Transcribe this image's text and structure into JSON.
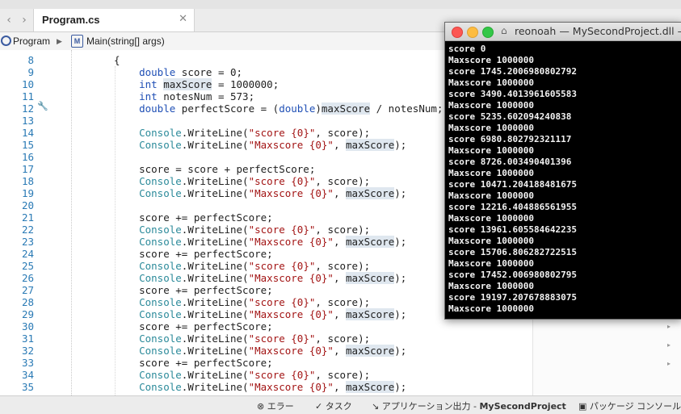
{
  "tabbar": {
    "back": "‹",
    "forward": "›",
    "tab_label": "Program.cs",
    "tab_close": "✕"
  },
  "breadcrumb": {
    "item1": "Program",
    "separator": "▶",
    "item2": "Main(string[] args)",
    "method_icon_text": "M"
  },
  "code": {
    "lines": [
      {
        "n": "8",
        "t": "{"
      },
      {
        "n": "9",
        "t": "    double score = 0;"
      },
      {
        "n": "10",
        "t": "    int maxScore = 1000000;"
      },
      {
        "n": "11",
        "t": "    int notesNum = 573;"
      },
      {
        "n": "12",
        "t": "    double perfectScore = (double)maxScore / notesNum;"
      },
      {
        "n": "13",
        "t": ""
      },
      {
        "n": "14",
        "t": "    Console.WriteLine(\"score {0}\", score);"
      },
      {
        "n": "15",
        "t": "    Console.WriteLine(\"Maxscore {0}\", maxScore);"
      },
      {
        "n": "16",
        "t": ""
      },
      {
        "n": "17",
        "t": "    score = score + perfectScore;"
      },
      {
        "n": "18",
        "t": "    Console.WriteLine(\"score {0}\", score);"
      },
      {
        "n": "19",
        "t": "    Console.WriteLine(\"Maxscore {0}\", maxScore);"
      },
      {
        "n": "20",
        "t": ""
      },
      {
        "n": "21",
        "t": "    score += perfectScore;"
      },
      {
        "n": "22",
        "t": "    Console.WriteLine(\"score {0}\", score);"
      },
      {
        "n": "23",
        "t": "    Console.WriteLine(\"Maxscore {0}\", maxScore);"
      },
      {
        "n": "24",
        "t": "    score += perfectScore;"
      },
      {
        "n": "25",
        "t": "    Console.WriteLine(\"score {0}\", score);"
      },
      {
        "n": "26",
        "t": "    Console.WriteLine(\"Maxscore {0}\", maxScore);"
      },
      {
        "n": "27",
        "t": "    score += perfectScore;"
      },
      {
        "n": "28",
        "t": "    Console.WriteLine(\"score {0}\", score);"
      },
      {
        "n": "29",
        "t": "    Console.WriteLine(\"Maxscore {0}\", maxScore);"
      },
      {
        "n": "30",
        "t": "    score += perfectScore;"
      },
      {
        "n": "31",
        "t": "    Console.WriteLine(\"score {0}\", score);"
      },
      {
        "n": "32",
        "t": "    Console.WriteLine(\"Maxscore {0}\", maxScore);"
      },
      {
        "n": "33",
        "t": "    score += perfectScore;"
      },
      {
        "n": "34",
        "t": "    Console.WriteLine(\"score {0}\", score);"
      },
      {
        "n": "35",
        "t": "    Console.WriteLine(\"Maxscore {0}\", maxScore);"
      }
    ]
  },
  "terminal": {
    "title": "reonoah — MySecondProject.dll —",
    "lines": [
      "score 0",
      "Maxscore 1000000",
      "score 1745.2006980802792",
      "Maxscore 1000000",
      "score 3490.4013961605583",
      "Maxscore 1000000",
      "score 5235.602094240838",
      "Maxscore 1000000",
      "score 6980.802792321117",
      "Maxscore 1000000",
      "score 8726.003490401396",
      "Maxscore 1000000",
      "score 10471.204188481675",
      "Maxscore 1000000",
      "score 12216.404886561955",
      "Maxscore 1000000",
      "score 13961.605584642235",
      "Maxscore 1000000",
      "score 15706.806282722515",
      "Maxscore 1000000",
      "score 17452.006980802795",
      "Maxscore 1000000",
      "score 19197.207678883075",
      "Maxscore 1000000"
    ]
  },
  "statusbar": {
    "errors": "エラー",
    "tasks": "タスク",
    "app_output_prefix": "アプリケーション出力 - ",
    "app_output_project": "MySecondProject",
    "package_console": "パッケージ コンソール"
  },
  "colors": {
    "keyword": "#1f4fb5",
    "string": "#a31515",
    "console_class": "#2b8a9a",
    "line_number": "#2a7ab5",
    "highlight": "#dfe7ef",
    "close_dot": "#fc5753",
    "minimize_dot": "#fdbc40",
    "zoom_dot": "#33c748"
  }
}
